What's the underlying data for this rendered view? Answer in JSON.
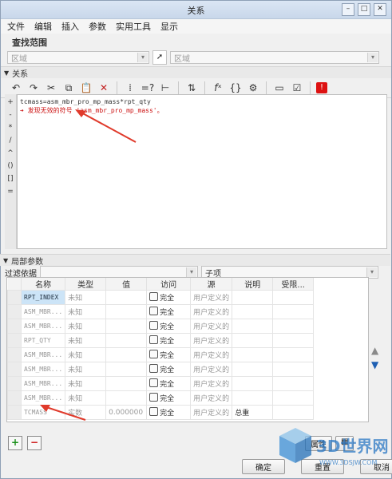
{
  "window": {
    "title": "关系",
    "controls": [
      "–",
      "□",
      "✕"
    ]
  },
  "menu": [
    "文件",
    "编辑",
    "插入",
    "参数",
    "实用工具",
    "显示"
  ],
  "scope": {
    "heading": "查找范围",
    "left_value": "区域",
    "right_value": "区域"
  },
  "relations_panel": {
    "label": "关系"
  },
  "operators": [
    "+",
    "-",
    "*",
    "/",
    "^",
    "()",
    "[]",
    "="
  ],
  "editor": {
    "lines": [
      {
        "text": "tcmass=asm_mbr_pro_mp_mass*rpt_qty",
        "kind": "normal"
      },
      {
        "text": "发现无效的符号 'asm_mbr_pro_mp_mass'。",
        "kind": "error"
      }
    ]
  },
  "local_params": {
    "label": "局部参数",
    "filter_label": "过滤依据",
    "filter_value": "",
    "sub_value": "子项"
  },
  "table": {
    "headers": [
      "名称",
      "类型",
      "值",
      "访问",
      "源",
      "说明",
      "受限..."
    ],
    "rows": [
      {
        "name": "RPT_INDEX",
        "type": "未知",
        "value": "",
        "access": "完全",
        "source": "用户定义的",
        "desc": "",
        "selected": true
      },
      {
        "name": "ASM_MBR...",
        "type": "未知",
        "value": "",
        "access": "完全",
        "source": "用户定义的",
        "desc": ""
      },
      {
        "name": "ASM_MBR...",
        "type": "未知",
        "value": "",
        "access": "完全",
        "source": "用户定义的",
        "desc": ""
      },
      {
        "name": "RPT_QTY",
        "type": "未知",
        "value": "",
        "access": "完全",
        "source": "用户定义的",
        "desc": ""
      },
      {
        "name": "ASM_MBR...",
        "type": "未知",
        "value": "",
        "access": "完全",
        "source": "用户定义的",
        "desc": ""
      },
      {
        "name": "ASM_MBR...",
        "type": "未知",
        "value": "",
        "access": "完全",
        "source": "用户定义的",
        "desc": ""
      },
      {
        "name": "ASM_MBR...",
        "type": "未知",
        "value": "",
        "access": "完全",
        "source": "用户定义的",
        "desc": ""
      },
      {
        "name": "ASM_MBR...",
        "type": "未知",
        "value": "",
        "access": "完全",
        "source": "用户定义的",
        "desc": ""
      },
      {
        "name": "TCMASS",
        "type": "实数",
        "value": "0.000000",
        "access": "完全",
        "source": "用户定义的",
        "desc": "总重"
      }
    ]
  },
  "buttons": {
    "add": "+",
    "remove": "−",
    "properties": "属性",
    "ok": "确定",
    "reset": "重置",
    "cancel": "取消"
  },
  "watermark": {
    "title": "3D世界网",
    "url": "WWW.3DSJW.COM"
  },
  "colors": {
    "accent": "#1e5fb3",
    "error": "#cc1111",
    "selected": "#cce4f7",
    "annotation": "#e03a2b"
  }
}
